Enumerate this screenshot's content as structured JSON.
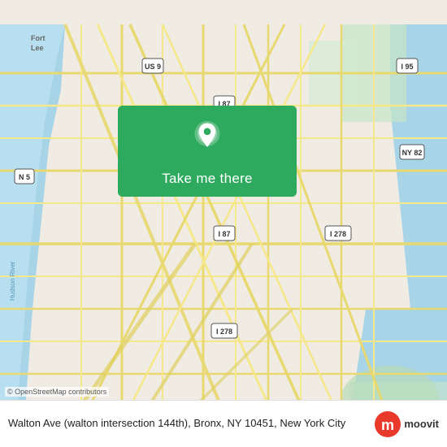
{
  "map": {
    "attribution": "© OpenStreetMap contributors",
    "background_color": "#f0ebe3"
  },
  "button": {
    "label": "Take me there",
    "background_color": "#2eaa5e"
  },
  "location": {
    "text": "Walton Ave (walton intersection 144th), Bronx, NY 10451, New York City"
  },
  "logo": {
    "name": "moovit",
    "icon_color": "#e8392a",
    "icon_letter": "m"
  },
  "route_labels": {
    "i87": "I 87",
    "i95": "I 95",
    "i278": "I 278",
    "us9": "US 9",
    "n5": "N 5",
    "ny82": "NY 82"
  }
}
